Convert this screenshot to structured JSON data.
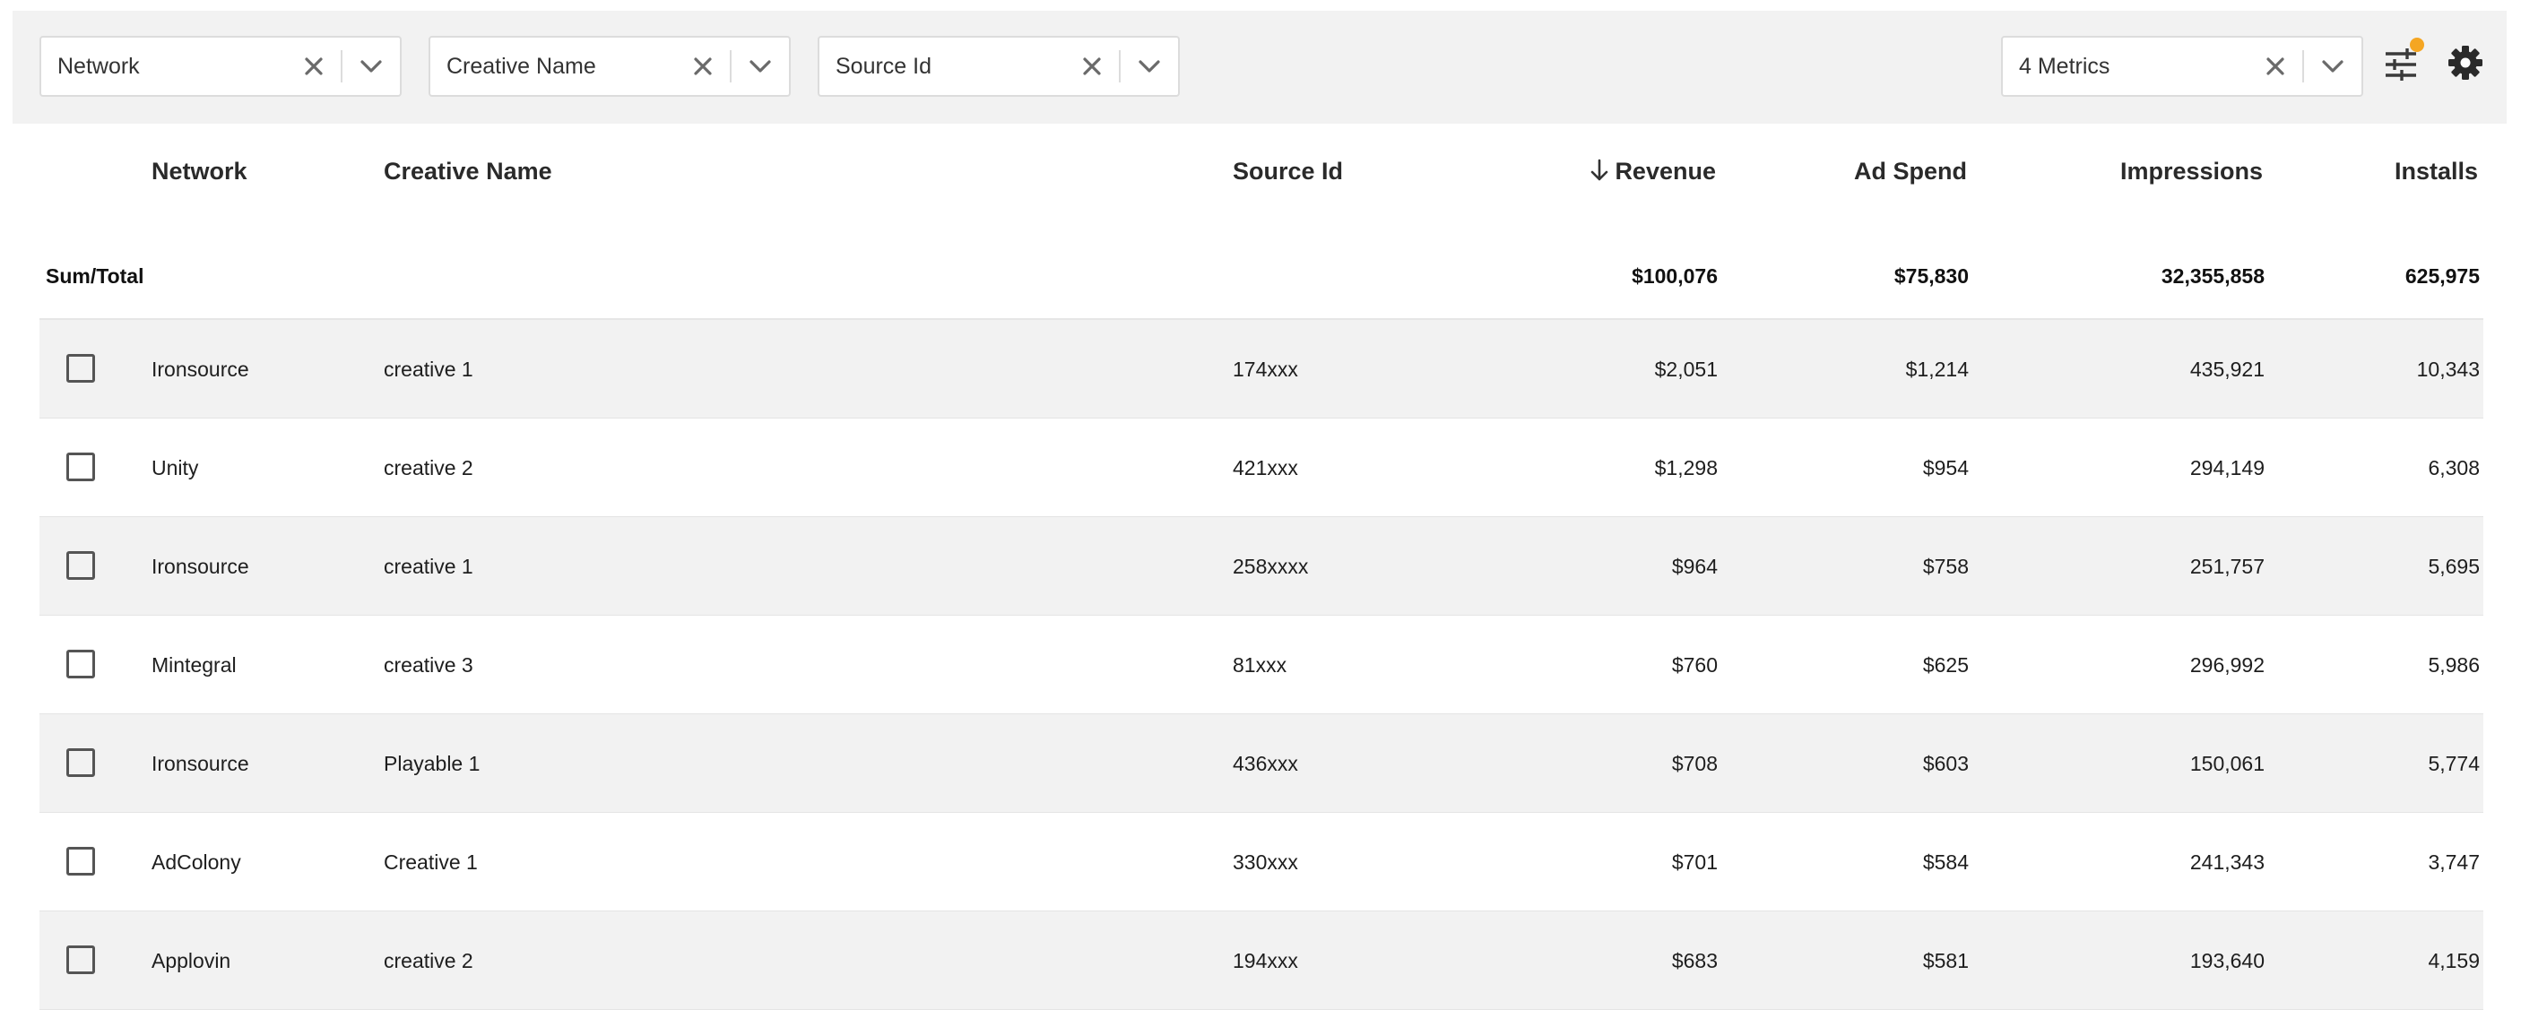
{
  "toolbar": {
    "filters": [
      {
        "label": "Network"
      },
      {
        "label": "Creative Name"
      },
      {
        "label": "Source Id"
      }
    ],
    "metrics": {
      "label": "4 Metrics"
    },
    "icons": {
      "clear": "close-icon",
      "expand": "chevron-down-icon",
      "tune": "tune-icon",
      "settings": "gear-icon"
    },
    "notification_color": "#f5a623"
  },
  "table": {
    "columns": {
      "network": "Network",
      "creative_name": "Creative Name",
      "source_id": "Source Id",
      "revenue": "Revenue",
      "ad_spend": "Ad Spend",
      "impressions": "Impressions",
      "installs": "Installs"
    },
    "sort": {
      "column": "revenue",
      "direction": "desc",
      "icon": "arrow-down-icon"
    },
    "totals": {
      "label": "Sum/Total",
      "revenue": "$100,076",
      "ad_spend": "$75,830",
      "impressions": "32,355,858",
      "installs": "625,975"
    },
    "rows": [
      {
        "network": "Ironsource",
        "creative_name": "creative 1",
        "source_id": "174xxx",
        "revenue": "$2,051",
        "ad_spend": "$1,214",
        "impressions": "435,921",
        "installs": "10,343"
      },
      {
        "network": "Unity",
        "creative_name": "creative 2",
        "source_id": "421xxx",
        "revenue": "$1,298",
        "ad_spend": "$954",
        "impressions": "294,149",
        "installs": "6,308"
      },
      {
        "network": "Ironsource",
        "creative_name": "creative 1",
        "source_id": "258xxxx",
        "revenue": "$964",
        "ad_spend": "$758",
        "impressions": "251,757",
        "installs": "5,695"
      },
      {
        "network": "Mintegral",
        "creative_name": "creative 3",
        "source_id": "81xxx",
        "revenue": "$760",
        "ad_spend": "$625",
        "impressions": "296,992",
        "installs": "5,986"
      },
      {
        "network": "Ironsource",
        "creative_name": "Playable 1",
        "source_id": "436xxx",
        "revenue": "$708",
        "ad_spend": "$603",
        "impressions": "150,061",
        "installs": "5,774"
      },
      {
        "network": "AdColony",
        "creative_name": "Creative 1",
        "source_id": "330xxx",
        "revenue": "$701",
        "ad_spend": "$584",
        "impressions": "241,343",
        "installs": "3,747"
      },
      {
        "network": "Applovin",
        "creative_name": "creative 2",
        "source_id": "194xxx",
        "revenue": "$683",
        "ad_spend": "$581",
        "impressions": "193,640",
        "installs": "4,159"
      }
    ]
  }
}
